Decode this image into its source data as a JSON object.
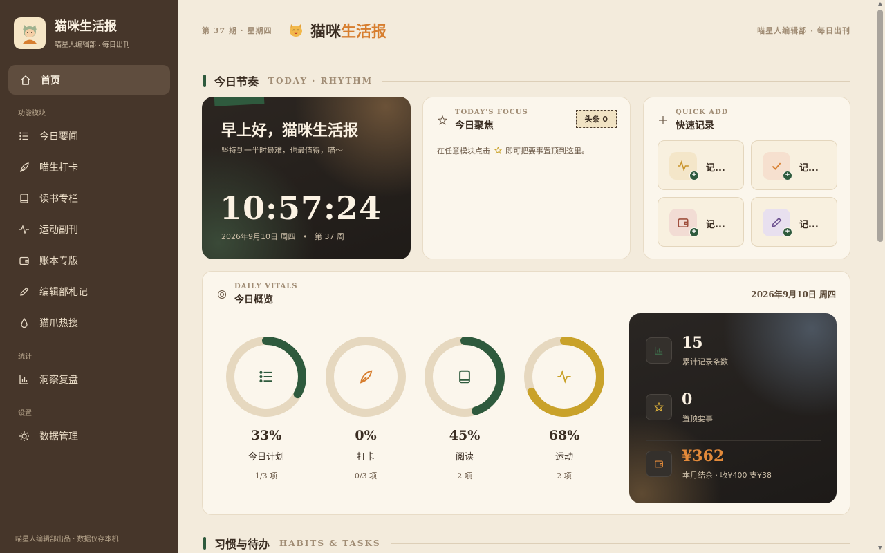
{
  "sidebar": {
    "brand_title": "猫咪生活报",
    "brand_sub": "喵星人编辑部 · 每日出刊",
    "home_label": "首页",
    "section_modules": "功能模块",
    "items": [
      {
        "label": "今日要闻",
        "icon": "list-icon"
      },
      {
        "label": "喵生打卡",
        "icon": "feather-icon"
      },
      {
        "label": "读书专栏",
        "icon": "book-icon"
      },
      {
        "label": "运动副刊",
        "icon": "pulse-icon"
      },
      {
        "label": "账本专版",
        "icon": "wallet-icon"
      },
      {
        "label": "编辑部札记",
        "icon": "pencil-icon"
      },
      {
        "label": "猫爪热搜",
        "icon": "drop-icon"
      }
    ],
    "section_stats": "统计",
    "insights_label": "洞察复盘",
    "section_settings": "设置",
    "data_label": "数据管理",
    "footer": "喵星人编辑部出品 · 数据仅存本机"
  },
  "masthead": {
    "issue": "第 37 期 · 星期四",
    "title_a": "猫咪",
    "title_b": "生活报",
    "right": "喵星人编辑部 · 每日出刊"
  },
  "section_today": {
    "zh": "今日节奏",
    "en": "TODAY · RHYTHM"
  },
  "greeting": {
    "hello": "早上好，猫咪生活报",
    "sub": "坚持到一半时最难，也最值得，喵～",
    "time": "10:57:24",
    "date": "2026年9月10日 周四",
    "sep": "•",
    "issue": "第 37 周"
  },
  "focus": {
    "en": "TODAY'S FOCUS",
    "zh": "今日聚焦",
    "badge": "头条 0",
    "hint_a": "在任意模块点击",
    "hint_b": "即可把要事置顶到这里。"
  },
  "quick_add": {
    "en": "QUICK ADD",
    "zh": "快速记录",
    "tiles": [
      {
        "label": "记...",
        "icon": "pulse-icon",
        "bg": "#f4e6c9",
        "fg": "#c9932a"
      },
      {
        "label": "记...",
        "icon": "check-icon",
        "bg": "#f6e0cf",
        "fg": "#d77e2f"
      },
      {
        "label": "记...",
        "icon": "wallet-icon",
        "bg": "#f2dcd4",
        "fg": "#a0503e"
      },
      {
        "label": "记...",
        "icon": "pencil-icon",
        "bg": "#e8e0ef",
        "fg": "#6b4f8f"
      }
    ]
  },
  "vitals": {
    "en": "DAILY VITALS",
    "zh": "今日概览",
    "date": "2026年9月10日 周四",
    "rings": [
      {
        "pct_text": "33%",
        "value": 0.33,
        "name": "今日计划",
        "count": "1/3 项",
        "color": "#2e5a3d",
        "icon": "list-icon"
      },
      {
        "pct_text": "0%",
        "value": 0,
        "name": "打卡",
        "count": "0/3 项",
        "color": "#d77e2f",
        "icon": "feather-icon"
      },
      {
        "pct_text": "45%",
        "value": 0.45,
        "name": "阅读",
        "count": "2 项",
        "color": "#2e5a3d",
        "icon": "book-icon"
      },
      {
        "pct_text": "68%",
        "value": 0.68,
        "name": "运动",
        "count": "2 项",
        "color": "#c9a22a",
        "icon": "pulse-icon"
      }
    ],
    "stats": [
      {
        "value": "15",
        "caption": "累计记录条数",
        "icon": "bar-chart-icon"
      },
      {
        "value": "0",
        "caption": "置顶要事",
        "icon": "star-icon"
      },
      {
        "value": "¥362",
        "caption": "本月结余 · 收¥400 支¥38",
        "icon": "wallet-icon"
      }
    ]
  },
  "section_habits": {
    "zh": "习惯与待办",
    "en": "HABITS & TASKS"
  },
  "colors": {
    "accent_green": "#2e5a3d",
    "accent_orange": "#d77e2f",
    "sidebar_bg": "#46362a"
  }
}
